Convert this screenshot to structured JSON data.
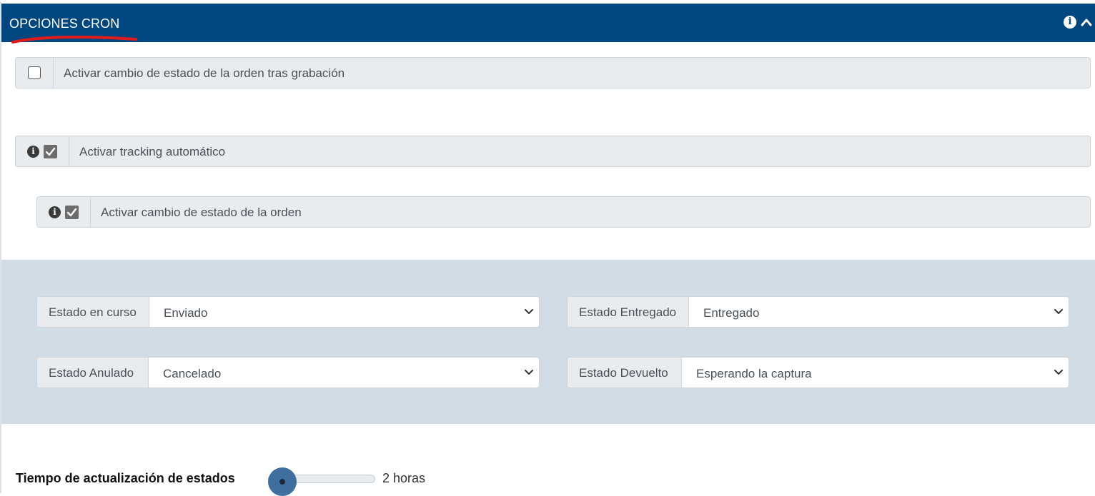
{
  "header": {
    "title": "OPCIONES CRON",
    "info_icon": "info-circle-icon",
    "collapse_icon": "chevron-up-icon"
  },
  "options": [
    {
      "label": "Activar cambio de estado de la orden tras grabación",
      "checked": false
    },
    {
      "label": "Activar tracking automático",
      "checked": true,
      "has_info": true
    },
    {
      "label": "Activar cambio de estado de la orden",
      "checked": true,
      "has_info": true
    }
  ],
  "status_selects": {
    "in_progress": {
      "label": "Estado en curso",
      "value": "Enviado"
    },
    "delivered": {
      "label": "Estado Entregado",
      "value": "Entregado"
    },
    "cancelled": {
      "label": "Estado Anulado",
      "value": "Cancelado"
    },
    "returned": {
      "label": "Estado Devuelto",
      "value": "Esperando la captura"
    }
  },
  "update_time": {
    "label": "Tiempo de actualización de estados",
    "value_text": "2 horas",
    "fill_fraction": 0.0
  },
  "colors": {
    "header_bg": "#00467f",
    "panel_bg": "#d1dce5",
    "annotation_red": "#e21a1a",
    "slider_thumb": "#3e6f9e"
  }
}
